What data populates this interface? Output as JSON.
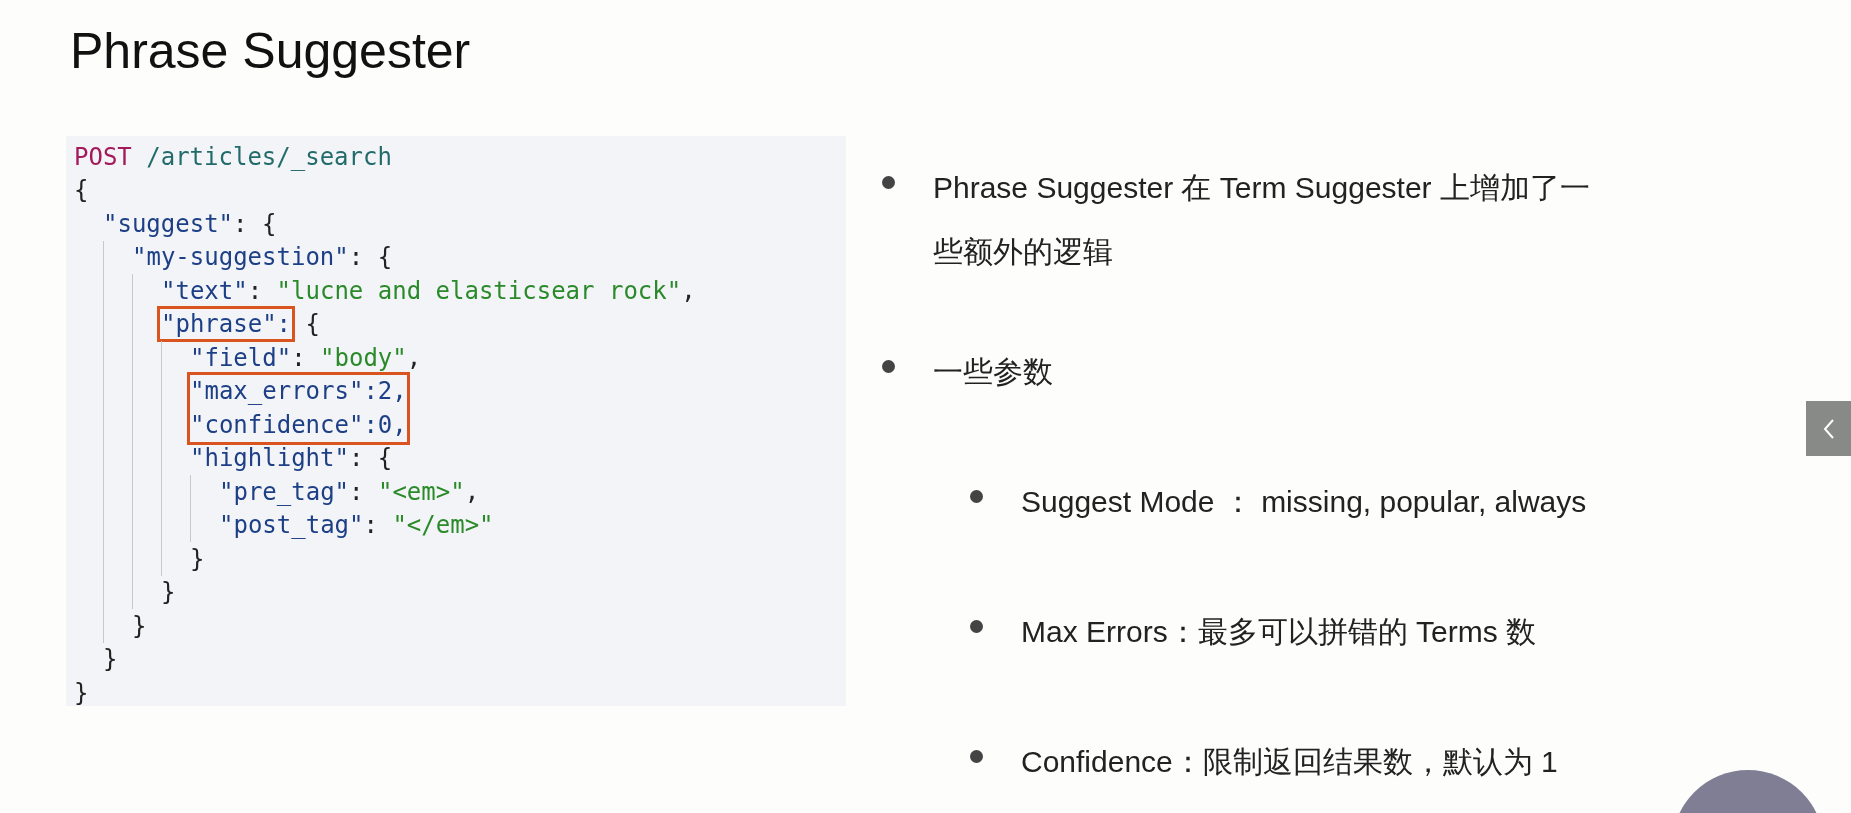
{
  "slide": {
    "title": "Phrase Suggester",
    "code": [
      [
        {
          "text": "POST",
          "kind": "method"
        },
        {
          "text": " /articles/_search",
          "kind": "path"
        }
      ],
      [
        {
          "text": "{",
          "kind": "punct"
        }
      ],
      [
        {
          "text": "\"suggest\"",
          "kind": "key"
        },
        {
          "text": ": {",
          "kind": "punct"
        }
      ],
      [
        {
          "text": "\"my-suggestion\"",
          "kind": "key"
        },
        {
          "text": ": {",
          "kind": "punct"
        }
      ],
      [
        {
          "text": "\"text\"",
          "kind": "key"
        },
        {
          "text": ": ",
          "kind": "punct"
        },
        {
          "text": "\"lucne and elasticsear rock\"",
          "kind": "string"
        },
        {
          "text": ",",
          "kind": "punct"
        }
      ],
      [
        {
          "text": "\"phrase\":",
          "kind": "key",
          "boxed": true
        },
        {
          "text": " {",
          "kind": "punct"
        }
      ],
      [
        {
          "text": "\"field\"",
          "kind": "key"
        },
        {
          "text": ": ",
          "kind": "punct"
        },
        {
          "text": "\"body\"",
          "kind": "string"
        },
        {
          "text": ",",
          "kind": "punct"
        }
      ],
      [
        {
          "text": "\"max_errors\":2,",
          "kind": "key",
          "boxed": true
        }
      ],
      [
        {
          "text": "\"confidence\":0,",
          "kind": "key",
          "boxed": true
        }
      ],
      [
        {
          "text": "\"highlight\"",
          "kind": "key"
        },
        {
          "text": ": {",
          "kind": "punct"
        }
      ],
      [
        {
          "text": "\"pre_tag\"",
          "kind": "key"
        },
        {
          "text": ": ",
          "kind": "punct"
        },
        {
          "text": "\"<em>\"",
          "kind": "string"
        },
        {
          "text": ",",
          "kind": "punct"
        }
      ],
      [
        {
          "text": "\"post_tag\"",
          "kind": "key"
        },
        {
          "text": ": ",
          "kind": "punct"
        },
        {
          "text": "\"</em>\"",
          "kind": "string"
        }
      ],
      [
        {
          "text": "}",
          "kind": "punct"
        }
      ],
      [
        {
          "text": "}",
          "kind": "punct"
        }
      ],
      [
        {
          "text": "}",
          "kind": "punct"
        }
      ],
      [
        {
          "text": "}",
          "kind": "punct"
        }
      ],
      [
        {
          "text": "}",
          "kind": "punct"
        }
      ]
    ],
    "bullets": [
      {
        "text": "Phrase Suggester 在 Term Suggester 上增加了一些额外的逻辑"
      },
      {
        "text": "一些参数",
        "children": [
          {
            "text": "Suggest Mode ： missing, popular, always"
          },
          {
            "text": "Max Errors：最多可以拼错的 Terms 数"
          },
          {
            "text": "Confidence：限制返回结果数，默认为 1"
          }
        ]
      }
    ]
  }
}
